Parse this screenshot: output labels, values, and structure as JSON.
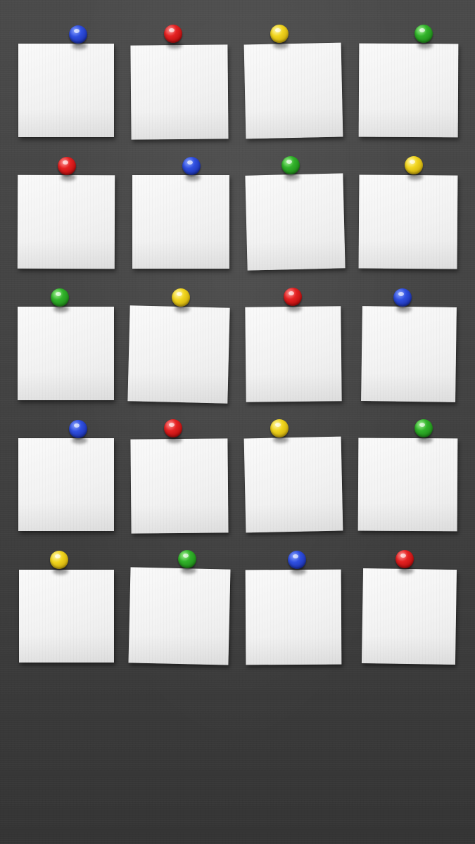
{
  "board": {
    "background_color": "#434343",
    "pin_colors": {
      "blue": "#2f4fe0",
      "red": "#e52222",
      "yellow": "#f1d51e",
      "green": "#31b32a"
    },
    "rows": [
      [
        "blue",
        "red",
        "yellow",
        "green"
      ],
      [
        "red",
        "blue",
        "green",
        "yellow"
      ],
      [
        "green",
        "yellow",
        "red",
        "blue"
      ],
      [
        "blue",
        "red",
        "yellow",
        "green"
      ],
      [
        "yellow",
        "green",
        "blue",
        "red"
      ]
    ]
  }
}
